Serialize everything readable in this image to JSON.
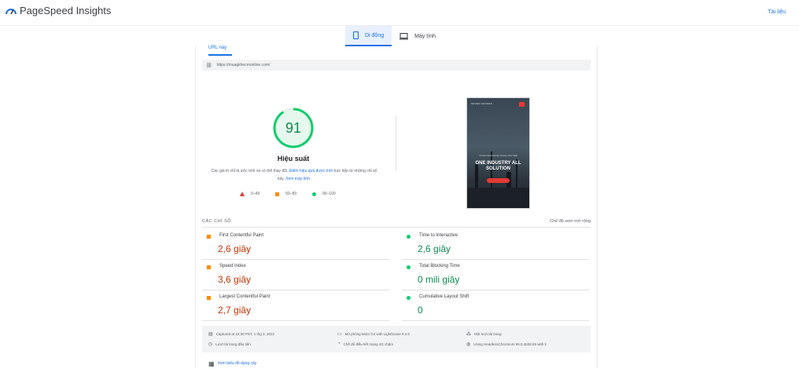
{
  "header": {
    "app_title": "PageSpeed Insights",
    "docs_link": "Tài liệu"
  },
  "device_tabs": [
    {
      "label": "Di động",
      "active": true
    },
    {
      "label": "Máy tính",
      "active": false
    }
  ],
  "url_tab": "URL này",
  "url_bar": {
    "icon": "link-icon",
    "url": "https://muagkhecmonline.com/"
  },
  "performance": {
    "score": "91",
    "title": "Hiệu suất",
    "desc_1": "Các giá trị chỉ là ước tính và có thể thay đổi.",
    "desc_link1": "Điểm hiệu quả được tính",
    "desc_2": "trực tiếp từ những chỉ số này.",
    "desc_link2": "Xem máy tính.",
    "legend": [
      "0–49",
      "50–89",
      "90–100"
    ]
  },
  "preview": {
    "brand": "SEVEN CRANES",
    "small": "Trusted manufacturing company since 1999",
    "headline": "ONE INDUSTRY ALL SOLUTION"
  },
  "metrics": {
    "heading": "CÁC CHỈ SỐ",
    "expand": "Chế độ xem mở rộng",
    "items": [
      {
        "label": "First Contentful Paint",
        "value": "2,6 giây",
        "status": "average"
      },
      {
        "label": "Time to Interactive",
        "value": "2,6 giây",
        "status": "good"
      },
      {
        "label": "Speed Index",
        "value": "3,6 giây",
        "status": "average"
      },
      {
        "label": "Total Blocking Time",
        "value": "0 mili giây",
        "status": "good"
      },
      {
        "label": "Largest Contentful Paint",
        "value": "2,7 giây",
        "status": "average"
      },
      {
        "label": "Cumulative Layout Shift",
        "value": "0",
        "status": "good"
      }
    ]
  },
  "footer": {
    "captured": "Captured at 22:30 PST, 1 thg 3, 2022",
    "first_load": "Lượt tải trang đầu tiên",
    "emulation": "Mô phỏng Moto G4 with Lighthouse 9.3.0",
    "throttle": "Chế độ điều tiết mạng 4G chậm",
    "single_load": "Một lượt tải trang",
    "browser": "Using HeadlessChromium 95.0.4638.69 with lr"
  },
  "treemap": "Xem biểu đồ dạng cây",
  "colors": {
    "accent": "#1a73e8",
    "good": "#0cce6b",
    "average": "#fb8c00",
    "poor": "#e53935"
  }
}
